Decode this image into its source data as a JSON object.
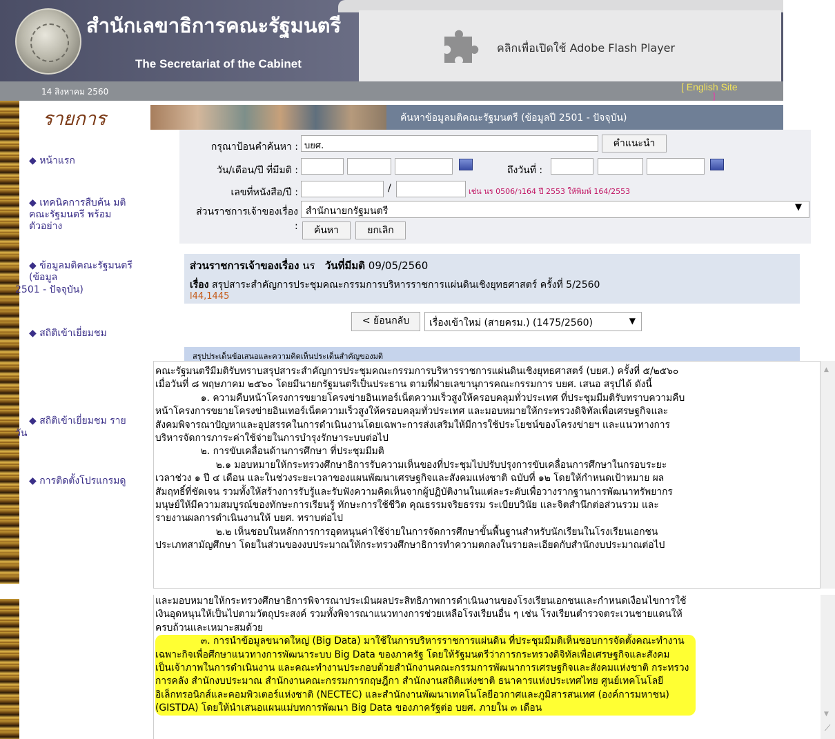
{
  "header": {
    "title_th": "สำนักเลขาธิการคณะรัฐมนตรี",
    "title_en": "The Secretariat of the Cabinet",
    "flash_text": "คลิกเพื่อเปิดใช้ Adobe Flash Player",
    "date": "14 สิงหาคม 2560",
    "english_link": "[ English Site",
    "english_link_close": "]"
  },
  "sidebar": {
    "title": "รายการ",
    "items": [
      {
        "label": "◆ หน้าแรก"
      },
      {
        "label": "◆ เทคนิคการสืบค้น มติคณะรัฐมนตรี พร้อมตัวอย่าง"
      },
      {
        "label": "◆ ข้อมูลมติคณะรัฐมนตรี (ข้อมูล"
      },
      {
        "label": "2501 - ปัจจุบัน)"
      },
      {
        "label": "◆ สถิติเข้าเยี่ยมชม"
      },
      {
        "label": "◆ สถิติเข้าเยี่ยมชม ราย"
      },
      {
        "label": "วัน"
      },
      {
        "label": "◆ การติดตั้งโปรแกรมดู"
      }
    ]
  },
  "banner": {
    "title": "ค้นหาข้อมูลมติคณะรัฐมนตรี (ข้อมูลปี 2501 - ปัจจุบัน)"
  },
  "search": {
    "keyword_label": "กรุณาป้อนคำค้นหา :",
    "keyword_value": "บยศ.",
    "suggest_button": "คำแนะนำ",
    "date_label": "วัน/เดือน/ปี ที่มีมติ :",
    "to_date_label": "ถึงวันที่ :",
    "doc_label": "เลขที่หนังสือ/ปี :",
    "doc_sep": "/",
    "doc_example": "เช่น นร 0506/ว164 ปี 2553 ให้พิมพ์ 164/2553",
    "agency_label": "ส่วนราชการเจ้าของเรื่อง",
    "agency_colon": ":",
    "agency_value": "สำนักนายกรัฐมนตรี",
    "search_button": "ค้นหา",
    "cancel_button": "ยกเลิก"
  },
  "result": {
    "agency_label": "ส่วนราชการเจ้าของเรื่อง",
    "agency_value": "นร",
    "date_label": "วันที่มีมติ",
    "date_value": "09/05/2560",
    "subject_label": "เรื่อง",
    "subject_value": "สรุปสาระสำคัญการประชุมคณะกรรมการบริหารราชการแผ่นดินเชิงยุทธศาสตร์ ครั้งที่ 5/2560",
    "ref": "l44,1445",
    "back_button": "< ย้อนกลับ",
    "type_select": "เรื่องเข้าใหม่ (สายครม.) (1475/2560)"
  },
  "summary": {
    "header": "สรุปประเด็นข้อเสนอและความคิดเห็นประเด็นสำคัญของมติ",
    "lines": [
      "คณะรัฐมนตรีมีมติรับทราบสรุปสาระสำคัญการประชุมคณะกรรมการบริหารราชการแผ่นดินเชิงยุทธศาสตร์ (บยศ.) ครั้งที่ ๕/๒๕๖๐",
      "เมื่อวันที่ ๘ พฤษภาคม ๒๕๖๐ โดยมีนายกรัฐมนตรีเป็นประธาน ตามที่ฝ่ายเลขานุการคณะกรรมการ บยศ. เสนอ สรุปได้ ดังนี้",
      "               ๑. ความคืบหน้าโครงการขยายโครงข่ายอินเทอร์เน็ตความเร็วสูงให้ครอบคลุมทั่วประเทศ ที่ประชุมมีมติรับทราบความคืบ",
      "หน้าโครงการขยายโครงข่ายอินเทอร์เน็ตความเร็วสูงให้ครอบคลุมทั่วประเทศ และมอบหมายให้กระทรวงดิจิทัลเพื่อเศรษฐกิจและ",
      "สังคมพิจารณาปัญหาและอุปสรรคในการดำเนินงานโดยเฉพาะการส่งเสริมให้มีการใช้ประโยชน์ของโครงข่ายฯ และแนวทางการ",
      "บริหารจัดการภาระค่าใช้จ่ายในการบำรุงรักษาระบบต่อไป",
      "               ๒. การขับเคลื่อนด้านการศึกษา ที่ประชุมมีมติ",
      "                    ๒.๑ มอบหมายให้กระทรวงศึกษาธิการรับความเห็นของที่ประชุมไปปรับปรุงการขับเคลื่อนการศึกษาในกรอบระยะ",
      "เวลาช่วง ๑ ปี ๔ เดือน และในช่วงระยะเวลาของแผนพัฒนาเศรษฐกิจและสังคมแห่งชาติ ฉบับที่ ๑๒ โดยให้กำหนดเป้าหมาย ผล",
      "สัมฤทธิ์ที่ชัดเจน รวมทั้งให้สร้างการรับรู้และรับฟังความคิดเห็นจากผู้ปฏิบัติงานในแต่ละระดับเพื่อวางรากฐานการพัฒนาทรัพยากร",
      "มนุษย์ให้มีความสมบูรณ์ของทักษะการเรียนรู้ ทักษะการใช้ชีวิต คุณธรรมจริยธรรม ระเบียบวินัย และจิตสำนึกต่อส่วนรวม และ",
      "รายงานผลการดำเนินงานให้ บยศ. ทราบต่อไป",
      "                    ๒.๒ เห็นชอบในหลักการการอุดหนุนค่าใช้จ่ายในการจัดการศึกษาขั้นพื้นฐานสำหรับนักเรียนในโรงเรียนเอกชน",
      "ประเภทสามัญศึกษา โดยในส่วนของงบประมาณให้กระทรวงศึกษาธิการทำความตกลงในรายละเอียดกับสำนักงบประมาณต่อไป"
    ],
    "lines2": [
      "และมอบหมายให้กระทรวงศึกษาธิการพิจารณาประเมินผลประสิทธิภาพการดำเนินงานของโรงเรียนเอกชนและกำหนดเงื่อนไขการใช้",
      "เงินอุดหนุนให้เป็นไปตามวัตถุประสงค์ รวมทั้งพิจารณาแนวทางการช่วยเหลือโรงเรียนอื่น ๆ เช่น โรงเรียนตำรวจตระเวนชายแดนให้",
      "ครบถ้วนและเหมาะสมด้วย"
    ],
    "highlight": [
      "               ๓. การนำข้อมูลขนาดใหญ่ (Big Data) มาใช้ในการบริหารราชการแผ่นดิน ที่ประชุมมีมติเห็นชอบการจัดตั้งคณะทำงาน",
      "เฉพาะกิจเพื่อศึกษาแนวทางการพัฒนาระบบ Big Data ของภาครัฐ โดยให้รัฐมนตรีว่าการกระทรวงดิจิทัลเพื่อเศรษฐกิจและสังคม",
      "เป็นเจ้าภาพในการดำเนินงาน และคณะทำงานประกอบด้วยสำนักงานคณะกรรมการพัฒนาการเศรษฐกิจและสังคมแห่งชาติ กระทรวง",
      "การคลัง สำนักงบประมาณ สำนักงานคณะกรรมการกฤษฎีกา สำนักงานสถิติแห่งชาติ ธนาคารแห่งประเทศไทย ศูนย์เทคโนโลยี",
      "อิเล็กทรอนิกส์และคอมพิวเตอร์แห่งชาติ (NECTEC) และสำนักงานพัฒนาเทคโนโลยีอวกาศและภูมิสารสนเทศ (องค์การมหาชน)",
      "(GISTDA) โดยให้นำเสนอแผนแม่บทการพัฒนา Big Data ของภาครัฐต่อ บยศ. ภายใน ๓ เดือน"
    ]
  }
}
